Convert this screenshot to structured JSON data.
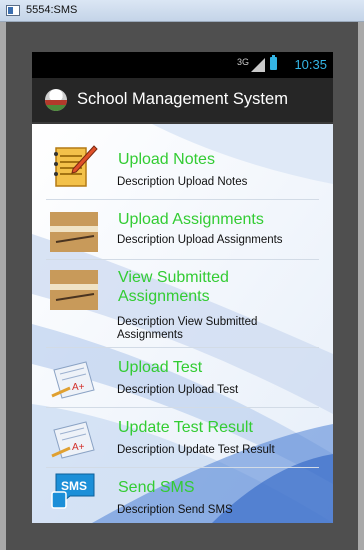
{
  "window": {
    "title": "5554:SMS"
  },
  "status_bar": {
    "network": "3G",
    "time": "10:35"
  },
  "action_bar": {
    "title": "School Management System",
    "logo_icon": "school-logo-icon"
  },
  "colors": {
    "accent": "#33cc33",
    "clock": "#34b5e5",
    "action_bar_bg": "#262626"
  },
  "menu": [
    {
      "title": "Upload Notes",
      "description": "Description Upload Notes",
      "icon": "notepad-pencil-icon"
    },
    {
      "title": "Upload Assignments",
      "description": "Description Upload Assignments",
      "icon": "assignment-paper-icon"
    },
    {
      "title": "View Submitted Assignments",
      "description": "Description View Submitted Assignments",
      "icon": "assignment-paper-icon"
    },
    {
      "title": "Upload Test",
      "description": "Description Upload Test",
      "icon": "test-paper-icon"
    },
    {
      "title": "Update Test Result",
      "description": "Description Update Test Result",
      "icon": "test-paper-icon"
    },
    {
      "title": "Send SMS",
      "description": "Description Send SMS",
      "icon": "sms-icon"
    }
  ]
}
